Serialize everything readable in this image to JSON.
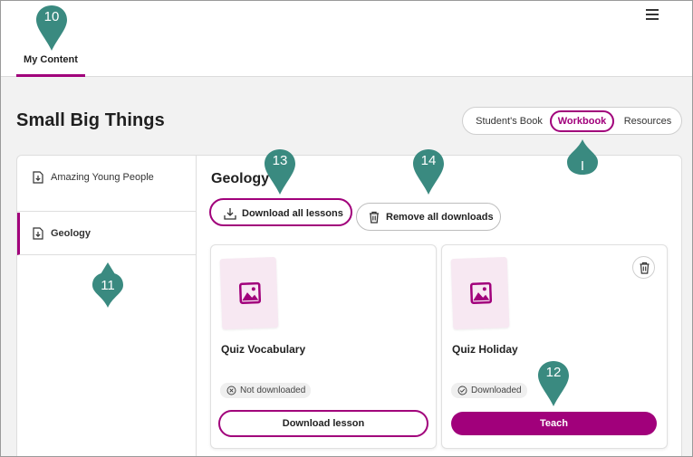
{
  "header": {
    "tab_label": "My Content"
  },
  "page": {
    "title": "Small Big Things"
  },
  "segmented": {
    "items": [
      "Student's Book",
      "Workbook",
      "Resources"
    ],
    "selected": "Workbook"
  },
  "sidebar": {
    "items": [
      {
        "label": "Amazing Young People"
      },
      {
        "label": "Geology"
      }
    ],
    "selected": "Geology"
  },
  "main": {
    "title": "Geology",
    "download_all_label": "Download all lessons",
    "remove_all_label": "Remove all downloads"
  },
  "cards": [
    {
      "title": "Quiz  Vocabulary",
      "status": "Not downloaded",
      "button": "Download lesson"
    },
    {
      "title": "Quiz  Holiday",
      "status": "Downloaded",
      "button": "Teach"
    }
  ],
  "markers": {
    "m10": "10",
    "m11": "11",
    "m12": "12",
    "m13": "13",
    "m14": "14",
    "mI": "I"
  },
  "colors": {
    "accent": "#a1007b",
    "marker": "#3a8a80"
  },
  "icons": {
    "menu": "hamburger-icon",
    "download": "download-icon",
    "trash": "trash-icon",
    "image": "image-icon",
    "status_not_downloaded": "x-circle-icon",
    "status_downloaded": "check-circle-icon"
  }
}
